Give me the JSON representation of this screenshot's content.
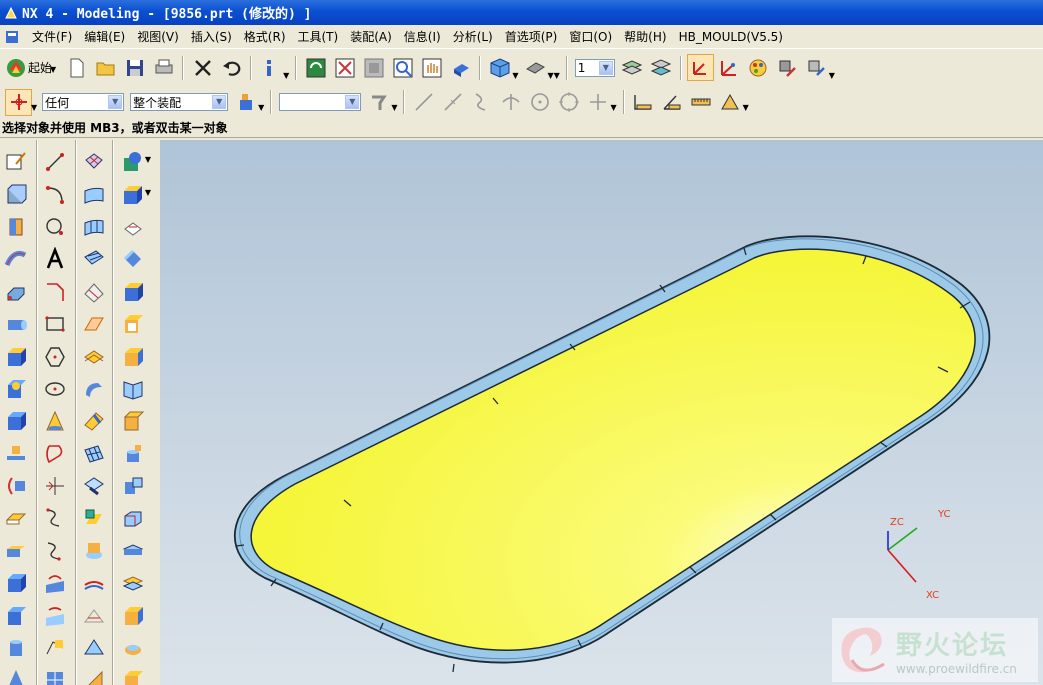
{
  "window": {
    "title": "NX 4 - Modeling - [9856.prt  (修改的) ]"
  },
  "menu": [
    "文件(F)",
    "编辑(E)",
    "视图(V)",
    "插入(S)",
    "格式(R)",
    "工具(T)",
    "装配(A)",
    "信息(I)",
    "分析(L)",
    "首选项(P)",
    "窗口(O)",
    "帮助(H)",
    "HB_MOULD(V5.5)"
  ],
  "toolbar": {
    "start_label": "起始",
    "layer_value": "1"
  },
  "selection": {
    "filter_value": "任何",
    "scope_value": "整个装配",
    "snap_value": ""
  },
  "cue_line": "选择对象并使用 MB3，或者双击某一对象",
  "triad": {
    "xc": "XC",
    "yc": "YC",
    "zc": "ZC"
  },
  "watermark": {
    "text": "野火论坛",
    "url": "www.proewildfire.cn"
  },
  "colors": {
    "titlebar": "#0a4fd1",
    "face": "#f6f63a",
    "edge": "#8ec4e6",
    "viewport_top": "#afc4d7"
  }
}
